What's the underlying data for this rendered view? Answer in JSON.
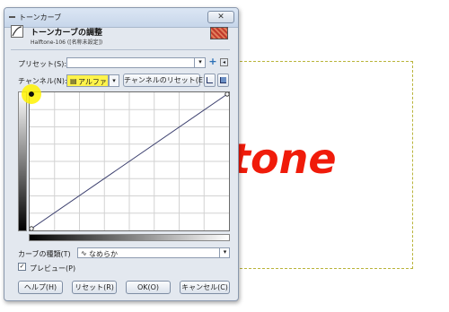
{
  "window": {
    "title": "トーンカーブ",
    "close_glyph": "✕"
  },
  "header": {
    "title": "トーンカーブの調整",
    "subtitle": "Halftone-106 ([名称未設定])"
  },
  "presets": {
    "label": "プリセット(S):",
    "value": "",
    "add_glyph": "+",
    "menu_glyph": "◂"
  },
  "channel": {
    "label": "チャンネル(N):",
    "value": "アルファ",
    "reset_label": "チャンネルのリセット(E)",
    "highlight_color": "#fff200"
  },
  "curve_type": {
    "label": "カーブの種類(T)",
    "value": "なめらか",
    "icon": "smooth-curve-icon"
  },
  "preview": {
    "label": "プレビュー(P)",
    "checked": true
  },
  "buttons": {
    "help": "ヘルプ(H)",
    "reset": "リセット(R)",
    "ok": "OK(O)",
    "cancel": "キャンセル(C)"
  },
  "canvas": {
    "text_visible": "tone",
    "text_color": "#f01b0a"
  },
  "icons": {
    "combo_arrow": "▾",
    "check": "✓"
  }
}
